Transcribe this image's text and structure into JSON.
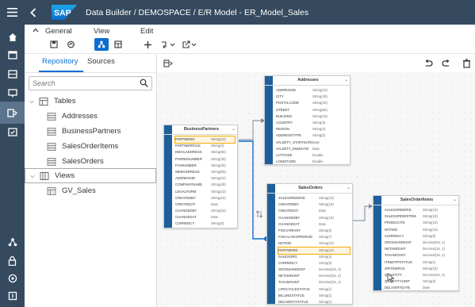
{
  "header": {
    "app_title": "Data Builder / DEMOSPACE / E/R Model - ER_Model_Sales",
    "logo_text": "SAP",
    "menu_icon": "hamburger-icon",
    "back_icon": "back-icon"
  },
  "side_nav": [
    "home-icon",
    "repository-icon",
    "data-builder-icon",
    "business-builder-icon",
    "data-integration-icon",
    "security-icon",
    "system-icon",
    "connections-icon",
    "settings-icon"
  ],
  "toolbar": {
    "general_label": "General",
    "view_label": "View",
    "edit_label": "Edit"
  },
  "repository": {
    "tabs": [
      "Repository",
      "Sources"
    ],
    "search_placeholder": "Search",
    "tables_label": "Tables",
    "tables": [
      "Addresses",
      "BusinessPartners",
      "SalesOrderItems",
      "SalesOrders"
    ],
    "views_label": "Views",
    "views": [
      "GV_Sales"
    ]
  },
  "entities": {
    "addresses": {
      "title": "Addresses",
      "columns": [
        [
          "ADDRESSID",
          "String(10)"
        ],
        [
          "CITY",
          "String(40)"
        ],
        [
          "POSTALCODE",
          "String(10)"
        ],
        [
          "STREET",
          "String(60)"
        ],
        [
          "BUILDING",
          "String(10)"
        ],
        [
          "COUNTRY",
          "String(3)"
        ],
        [
          "REGION",
          "String(4)"
        ],
        [
          "ADDRESSTYPE",
          "String(2)"
        ],
        [
          "VALIDITY_STARTDATE",
          "Date"
        ],
        [
          "VALIDITY_ENDDATE",
          "Date"
        ],
        [
          "LATITUDE",
          "Double"
        ],
        [
          "LONGITUDE",
          "Double"
        ]
      ]
    },
    "business_partners": {
      "title": "BusinessPartners",
      "columns": [
        [
          "PARTNERID",
          "String(10)"
        ],
        [
          "PARTNERROLE",
          "String(3)"
        ],
        [
          "EMAILADDRESS",
          "String(60)"
        ],
        [
          "PHONENUMBER",
          "String(30)"
        ],
        [
          "FAXNUMBER",
          "String(30)"
        ],
        [
          "WEBADDRESS",
          "String(60)"
        ],
        [
          "ADDRESSID",
          "String(10)"
        ],
        [
          "COMPANYNAME",
          "String(40)"
        ],
        [
          "LEGALFORM",
          "String(10)"
        ],
        [
          "CREATEDBY",
          "String(10)"
        ],
        [
          "CREATEDAT",
          "Date"
        ],
        [
          "CHANGEDBY",
          "String(10)"
        ],
        [
          "CHANGEDAT",
          "Date"
        ],
        [
          "CURRENCY",
          "String(5)"
        ]
      ]
    },
    "sales_orders": {
      "title": "SalesOrders",
      "columns": [
        [
          "SALESORDERID",
          "String(10)"
        ],
        [
          "CREATEDBY",
          "String(10)"
        ],
        [
          "CREATEDAT",
          "Date"
        ],
        [
          "CHANGEDBY",
          "String(10)"
        ],
        [
          "CHANGEDAT",
          "Date"
        ],
        [
          "FISCVARIANT",
          "String(2)"
        ],
        [
          "FISCALYEARPERIOD",
          "String(7)"
        ],
        [
          "NOTEID",
          "String(10)"
        ],
        [
          "PARTNERID",
          "String(10)"
        ],
        [
          "SALESORG",
          "String(4)"
        ],
        [
          "CURRENCY",
          "String(5)"
        ],
        [
          "GROSSAMOUNT",
          "Decimal(15, 2)"
        ],
        [
          "NETAMOUNT",
          "Decimal(15, 2)"
        ],
        [
          "TAXAMOUNT",
          "Decimal(15, 2)"
        ],
        [
          "LIFECYCLESTATUS",
          "String(1)"
        ],
        [
          "BILLINGSTATUS",
          "String(1)"
        ],
        [
          "DELIVERYSTATUS",
          "String(1)"
        ]
      ]
    },
    "sales_order_items": {
      "title": "SalesOrderItems",
      "columns": [
        [
          "SALESORDERID",
          "String(10)"
        ],
        [
          "SALESORDERITEM",
          "String(10)"
        ],
        [
          "PRODUCTID",
          "String(10)"
        ],
        [
          "NOTEID",
          "String(10)"
        ],
        [
          "CURRENCY",
          "String(5)"
        ],
        [
          "GROSSAMOUNT",
          "Decimal(15, 2)"
        ],
        [
          "NETAMOUNT",
          "Decimal(15, 2)"
        ],
        [
          "TAXAMOUNT",
          "Decimal(15, 2)"
        ],
        [
          "ITEMATPSTATUS",
          "String(1)"
        ],
        [
          "OPITEMPOS",
          "String(10)"
        ],
        [
          "QUANTITY",
          "Decimal(15, 2)"
        ],
        [
          "QUANTITYUNIT",
          "String(3)"
        ],
        [
          "DELIVERYDATE",
          "Date"
        ]
      ]
    }
  },
  "colors": {
    "shell": "#354a5f",
    "accent": "#0a6ed1",
    "entity_bar": "#1f5f99",
    "highlight": "#f0ab00",
    "association": "#f0ab00",
    "link_selected": "#0a6ed1"
  }
}
